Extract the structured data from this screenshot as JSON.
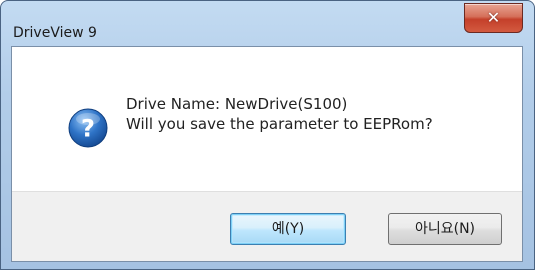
{
  "window": {
    "title": "DriveView 9",
    "close_icon": "close-icon"
  },
  "dialog": {
    "icon": "question-icon",
    "message_line1": "Drive Name: NewDrive(S100)",
    "message_line2": "Will you save the parameter to EEPRom?"
  },
  "buttons": {
    "yes_label": "예(Y)",
    "no_label": "아니요(N)"
  },
  "colors": {
    "title_bar": "#b2cde9",
    "close_button": "#c4402a",
    "footer": "#f0f0f0",
    "icon_blue": "#1f5fae"
  }
}
